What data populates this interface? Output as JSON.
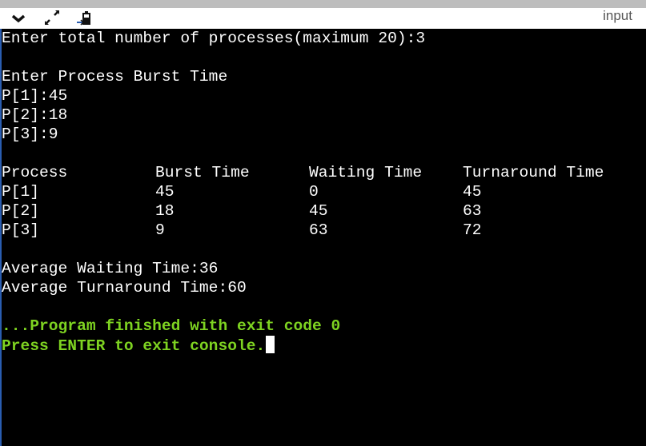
{
  "toolbar": {
    "icons": [
      "chevron-down-icon",
      "expand-icon",
      "paste-input-icon"
    ],
    "input_label": "input"
  },
  "console": {
    "prompt_count": "Enter total number of processes(maximum 20):3",
    "prompt_burst": "Enter Process Burst Time",
    "burst_inputs": [
      "P[1]:45",
      "P[2]:18",
      "P[3]:9"
    ],
    "table": {
      "headers": [
        "Process",
        "Burst Time",
        "Waiting Time",
        "Turnaround Time"
      ],
      "rows": [
        [
          "P[1]",
          "45",
          "0",
          "45"
        ],
        [
          "P[2]",
          "18",
          "45",
          "63"
        ],
        [
          "P[3]",
          "9",
          "63",
          "72"
        ]
      ]
    },
    "avg_waiting": "Average Waiting Time:36",
    "avg_turnaround": "Average Turnaround Time:60",
    "finished": "...Program finished with exit code 0",
    "press_enter": "Press ENTER to exit console."
  },
  "colors": {
    "success": "#7ed321",
    "background": "#000000"
  }
}
